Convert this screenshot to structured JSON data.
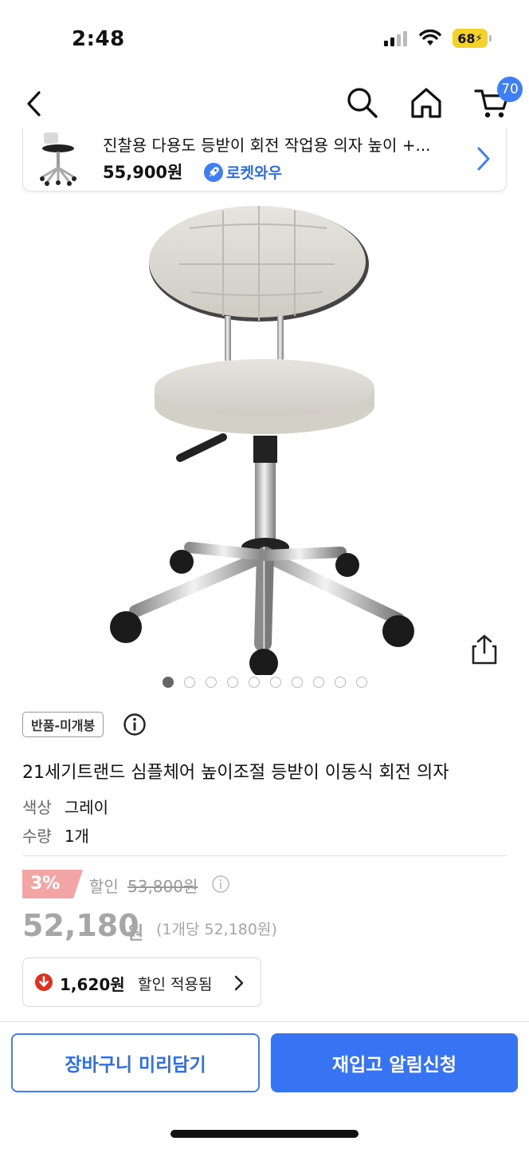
{
  "status": {
    "time": "2:48",
    "battery": "68"
  },
  "nav": {
    "cart_count": "70"
  },
  "mini_card": {
    "title": "진찰용 다용도 등받이 회전 작업용 의자 높이 +...",
    "price": "55,900원",
    "delivery_badge": "로켓와우"
  },
  "gallery": {
    "image_count": 10,
    "active_index": 0
  },
  "product": {
    "tag": "반품-미개봉",
    "title": "21세기트랜드 심플체어 높이조절 등받이 이동식 회전 의자",
    "options": [
      {
        "label": "색상",
        "value": "그레이"
      },
      {
        "label": "수량",
        "value": "1개"
      }
    ]
  },
  "pricing": {
    "discount_rate": "3%",
    "discount_label": "할인",
    "original_price": "53,800원",
    "sale_price": "52,180",
    "sale_unit": "원",
    "unit_price": "(1개당 52,180원)",
    "coupon_amount": "1,620원",
    "coupon_label": "할인 적용됨"
  },
  "actions": {
    "add_to_cart": "장바구니 미리담기",
    "restock_alert": "재입고 알림신청"
  },
  "colors": {
    "accent": "#3674f3",
    "discount_badge": "#f3a5a5",
    "price_muted": "#a6a6a6"
  }
}
